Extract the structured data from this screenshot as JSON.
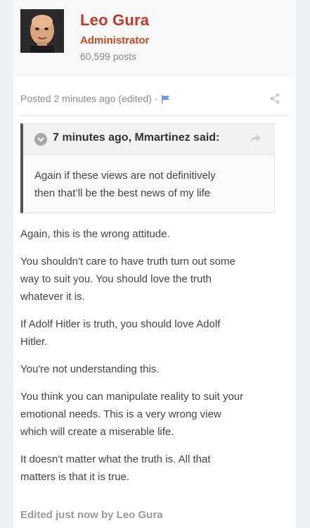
{
  "author": {
    "name": "Leo Gura",
    "role": "Administrator",
    "posts": "60,599 posts",
    "avatar_icon": "avatar-photo"
  },
  "post": {
    "posted_label": "Posted 2 minutes ago (edited) ·",
    "flag_icon": "flag-icon",
    "share_icon": "share-icon"
  },
  "quote": {
    "attribution": "7 minutes ago, Mmartinez said:",
    "lines": [
      "Again if these views are not definitively",
      "then that’ll be the best news of my life"
    ]
  },
  "content": {
    "paragraphs": [
      [
        "Again, this is the wrong attitude."
      ],
      [
        "You shouldn't care to have truth turn out some",
        "way to suit you. You should love the truth",
        "whatever it is."
      ],
      [
        "If Adolf Hitler is truth, you should love Adolf",
        "Hitler."
      ],
      [
        "You're not understanding this."
      ],
      [
        "You think you can manipulate reality to suit your",
        "emotional needs. This is a very wrong view",
        "which will create a miserable life."
      ],
      [
        "It doesn't matter what the truth is. All that",
        "matters is that it is true."
      ]
    ]
  },
  "edited_note": "Edited just now by Leo Gura",
  "colors": {
    "author_name": "#c0392b",
    "role": "#c04a1a",
    "flag": "#6f9fd8",
    "quote_border": "#555555"
  }
}
